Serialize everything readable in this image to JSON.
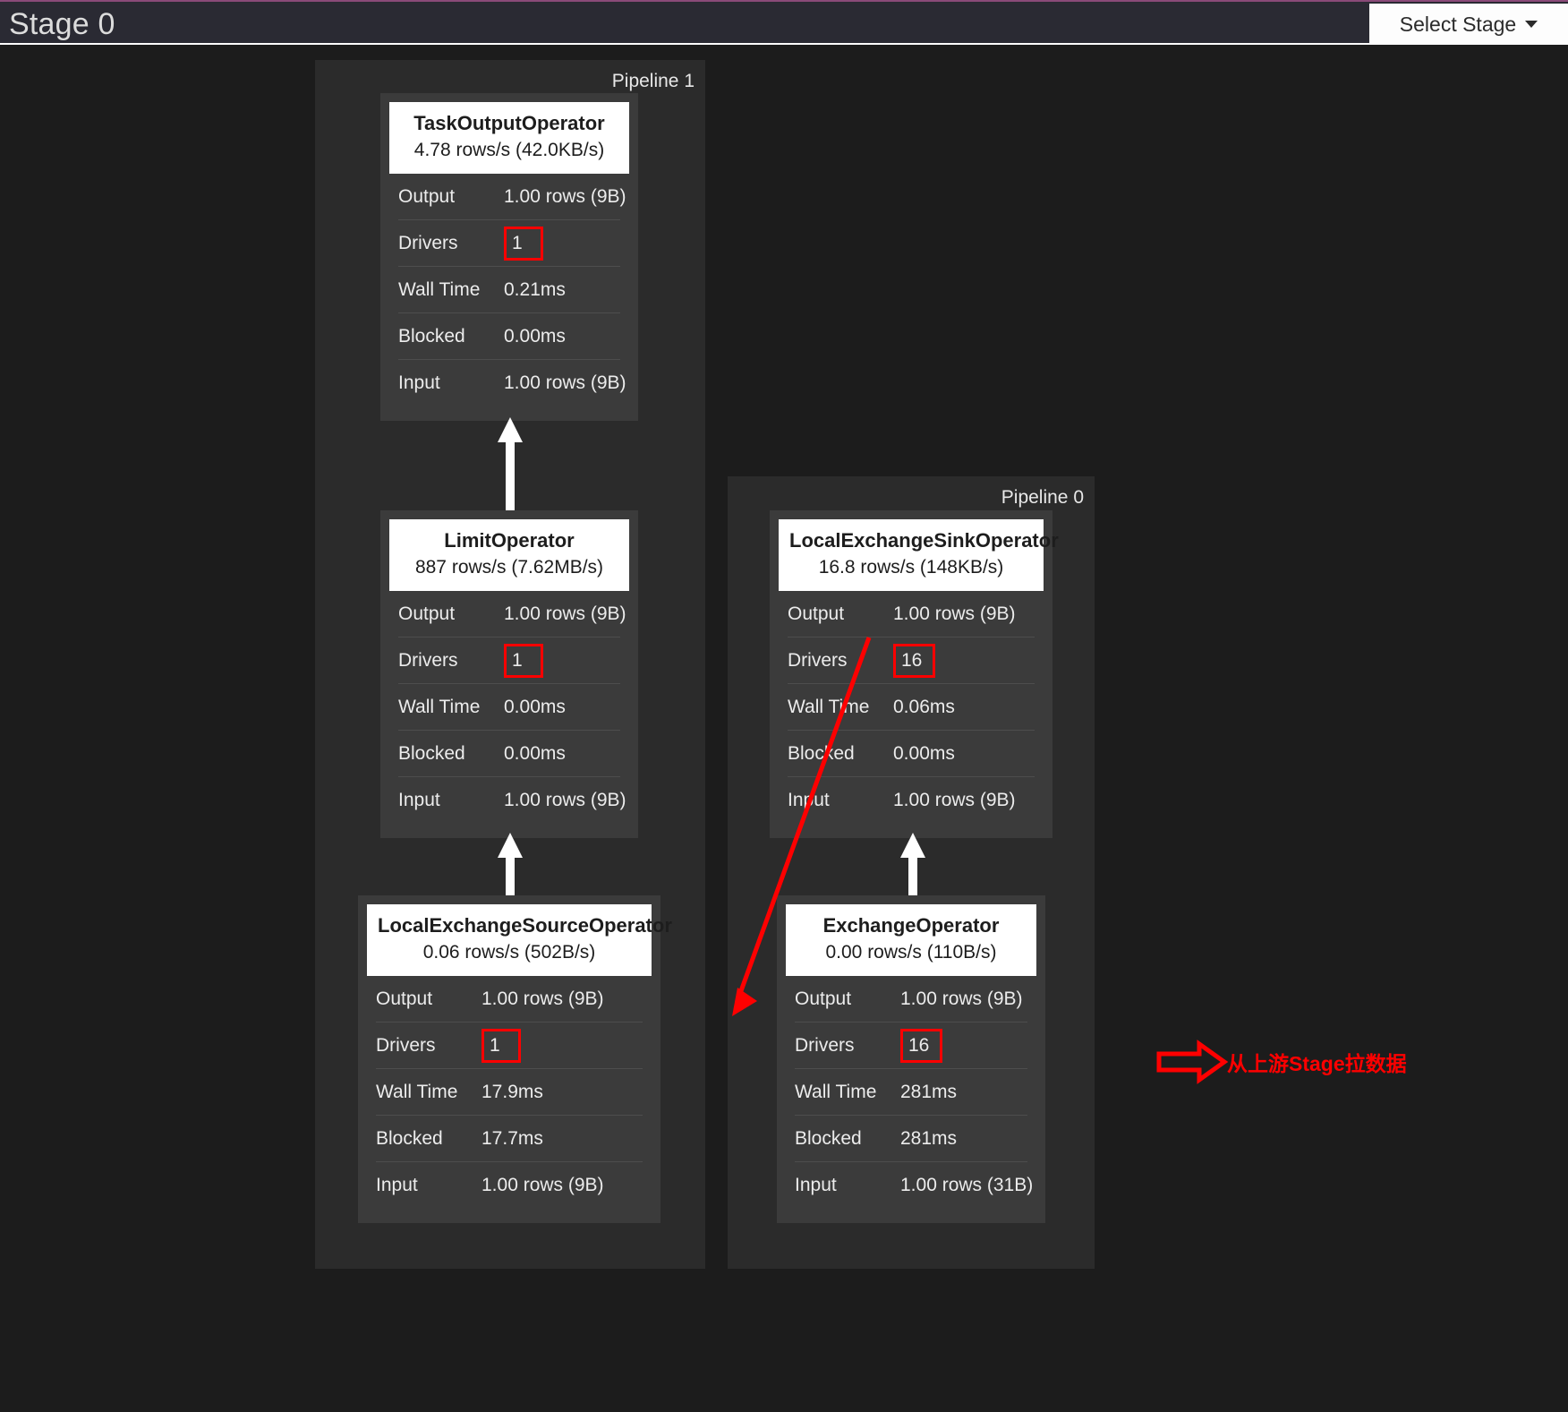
{
  "header": {
    "stage_title": "Stage 0",
    "select_stage_label": "Select Stage",
    "caret_icon": "chevron-down-icon"
  },
  "pipelines": [
    {
      "label": "Pipeline 1",
      "operators": [
        {
          "title": "TaskOutputOperator",
          "rate": "4.78 rows/s (42.0KB/s)",
          "rows": [
            {
              "key": "Output",
              "value": "1.00 rows (9B)",
              "highlight": false
            },
            {
              "key": "Drivers",
              "value": "1",
              "highlight": true
            },
            {
              "key": "Wall Time",
              "value": "0.21ms",
              "highlight": false
            },
            {
              "key": "Blocked",
              "value": "0.00ms",
              "highlight": false
            },
            {
              "key": "Input",
              "value": "1.00 rows (9B)",
              "highlight": false
            }
          ]
        },
        {
          "title": "LimitOperator",
          "rate": "887 rows/s (7.62MB/s)",
          "rows": [
            {
              "key": "Output",
              "value": "1.00 rows (9B)",
              "highlight": false
            },
            {
              "key": "Drivers",
              "value": "1",
              "highlight": true
            },
            {
              "key": "Wall Time",
              "value": "0.00ms",
              "highlight": false
            },
            {
              "key": "Blocked",
              "value": "0.00ms",
              "highlight": false
            },
            {
              "key": "Input",
              "value": "1.00 rows (9B)",
              "highlight": false
            }
          ]
        },
        {
          "title": "LocalExchangeSourceOperator",
          "rate": "0.06 rows/s (502B/s)",
          "rows": [
            {
              "key": "Output",
              "value": "1.00 rows (9B)",
              "highlight": false
            },
            {
              "key": "Drivers",
              "value": "1",
              "highlight": true
            },
            {
              "key": "Wall Time",
              "value": "17.9ms",
              "highlight": false
            },
            {
              "key": "Blocked",
              "value": "17.7ms",
              "highlight": false
            },
            {
              "key": "Input",
              "value": "1.00 rows (9B)",
              "highlight": false
            }
          ]
        }
      ]
    },
    {
      "label": "Pipeline 0",
      "operators": [
        {
          "title": "LocalExchangeSinkOperator",
          "rate": "16.8 rows/s (148KB/s)",
          "rows": [
            {
              "key": "Output",
              "value": "1.00 rows (9B)",
              "highlight": false
            },
            {
              "key": "Drivers",
              "value": "16",
              "highlight": true
            },
            {
              "key": "Wall Time",
              "value": "0.06ms",
              "highlight": false
            },
            {
              "key": "Blocked",
              "value": "0.00ms",
              "highlight": false
            },
            {
              "key": "Input",
              "value": "1.00 rows (9B)",
              "highlight": false
            }
          ]
        },
        {
          "title": "ExchangeOperator",
          "rate": "0.00 rows/s (110B/s)",
          "rows": [
            {
              "key": "Output",
              "value": "1.00 rows (9B)",
              "highlight": false
            },
            {
              "key": "Drivers",
              "value": "16",
              "highlight": true
            },
            {
              "key": "Wall Time",
              "value": "281ms",
              "highlight": false
            },
            {
              "key": "Blocked",
              "value": "281ms",
              "highlight": false
            },
            {
              "key": "Input",
              "value": "1.00 rows (31B)",
              "highlight": false
            }
          ]
        }
      ]
    }
  ],
  "annotations": {
    "upstream_pull_text": "从上游Stage拉数据",
    "annotation_color": "#ff0000"
  }
}
